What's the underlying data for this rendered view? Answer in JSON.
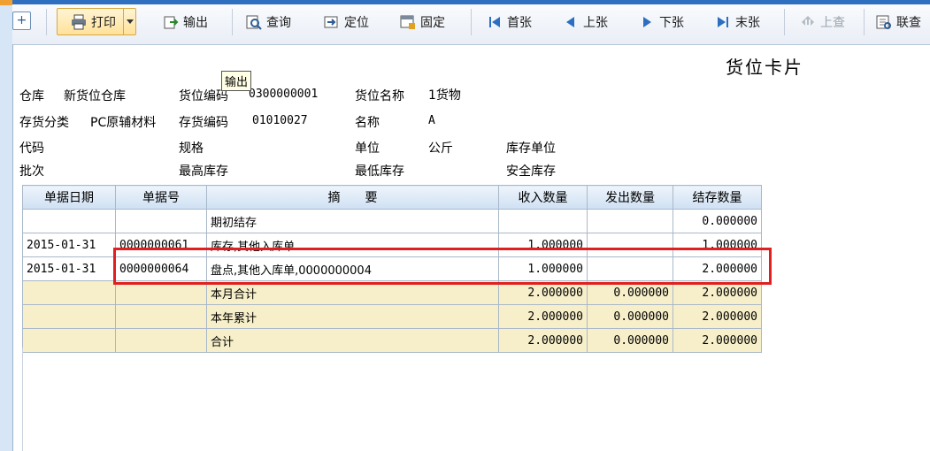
{
  "toolbar": {
    "items": [
      {
        "label": "打印",
        "icon": "printer-icon"
      },
      {
        "label": "输出",
        "icon": "export-icon"
      },
      {
        "label": "查询",
        "icon": "query-icon"
      },
      {
        "label": "定位",
        "icon": "locate-icon"
      },
      {
        "label": "固定",
        "icon": "pin-icon"
      },
      {
        "label": "首张",
        "icon": "first-icon"
      },
      {
        "label": "上张",
        "icon": "prev-icon"
      },
      {
        "label": "下张",
        "icon": "next-icon"
      },
      {
        "label": "末张",
        "icon": "last-icon"
      },
      {
        "label": "上查",
        "icon": "upquery-icon"
      },
      {
        "label": "联查",
        "icon": "linkquery-icon"
      }
    ],
    "add_symbol": "+"
  },
  "tooltip": "输出",
  "title": "货位卡片",
  "header": {
    "warehouse_label": "仓库",
    "warehouse_value": "新货位仓库",
    "loc_code_label": "货位编码",
    "loc_code_value": "0300000001",
    "loc_name_label": "货位名称",
    "loc_name_value": "1货物",
    "category_label": "存货分类",
    "category_value": "PC原辅材料",
    "inv_code_label": "存货编码",
    "inv_code_value": "01010027",
    "name_label": "名称",
    "name_value": "A",
    "code_label": "代码",
    "spec_label": "规格",
    "unit_label": "单位",
    "unit_value": "公斤",
    "stock_unit_label": "库存单位",
    "batch_label": "批次",
    "max_stock_label": "最高库存",
    "min_stock_label": "最低库存",
    "safe_stock_label": "安全库存"
  },
  "table": {
    "columns": [
      "单据日期",
      "单据号",
      "摘　　要",
      "收入数量",
      "发出数量",
      "结存数量"
    ],
    "rows": [
      {
        "date": "",
        "no": "",
        "summary": "期初结存",
        "in": "",
        "out": "",
        "balance": "0.000000"
      },
      {
        "date": "2015-01-31",
        "no": "0000000061",
        "summary": "库存,其他入库单",
        "in": "1.000000",
        "out": "",
        "balance": "1.000000"
      },
      {
        "date": "2015-01-31",
        "no": "0000000064",
        "summary": "盘点,其他入库单,0000000004",
        "in": "1.000000",
        "out": "",
        "balance": "2.000000"
      }
    ],
    "totals": [
      {
        "summary": "本月合计",
        "in": "2.000000",
        "out": "0.000000",
        "balance": "2.000000"
      },
      {
        "summary": "本年累计",
        "in": "2.000000",
        "out": "0.000000",
        "balance": "2.000000"
      },
      {
        "summary": "合计",
        "in": "2.000000",
        "out": "0.000000",
        "balance": "2.000000"
      }
    ]
  },
  "colors": {
    "accent": "#2f6fc0",
    "highlight": "#e02020",
    "total_row": "#f7efc9"
  }
}
